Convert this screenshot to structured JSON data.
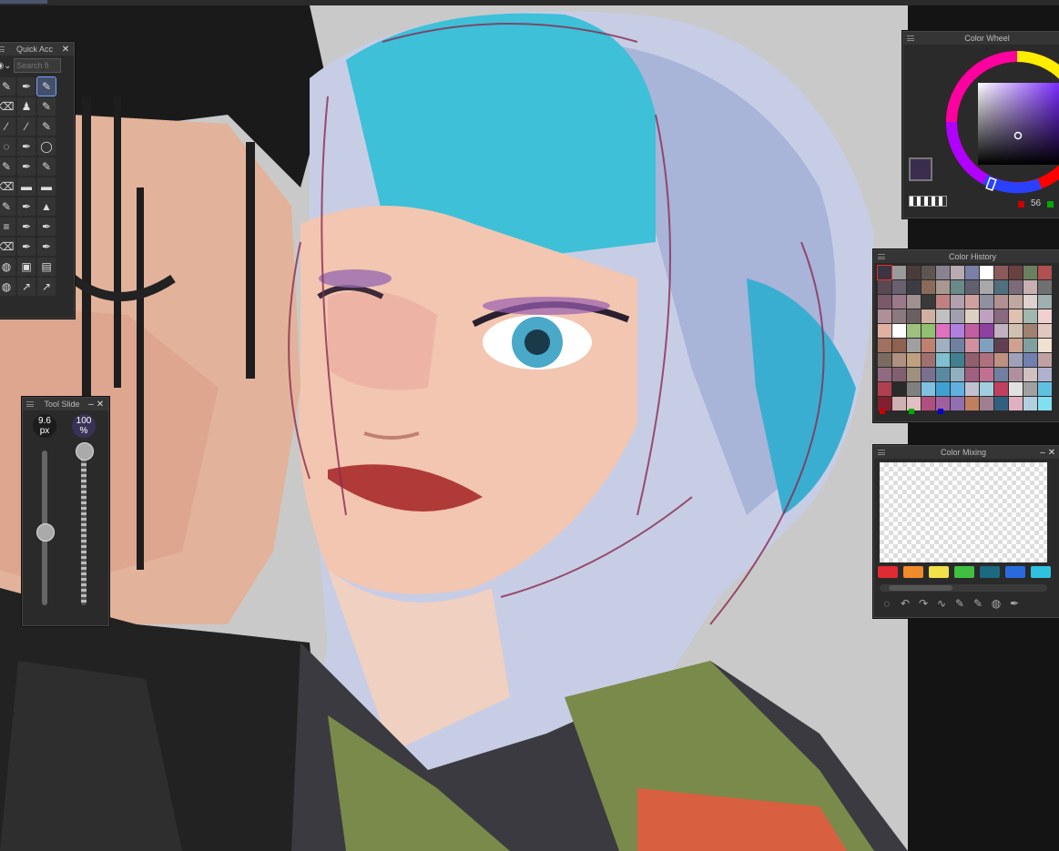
{
  "quick_access": {
    "title": "Quick Acc",
    "search_placeholder": "Search fi",
    "tools": [
      "✎",
      "✒",
      "✎",
      "⌫",
      "♟",
      "✎",
      "∕",
      "∕",
      "✎",
      "◌",
      "✒",
      "◯",
      "✎",
      "✒",
      "✎",
      "⌫",
      "▬",
      "▬",
      "✎",
      "✒",
      "▲",
      "≡",
      "✒",
      "✒",
      "⌫",
      "✒",
      "✒",
      "◍",
      "▣",
      "▤",
      "◍",
      "↗",
      "↗"
    ]
  },
  "tool_slider": {
    "title": "Tool Slide",
    "size_value": "9.6",
    "size_unit": "px",
    "opacity_value": "100",
    "opacity_unit": "%"
  },
  "color_wheel": {
    "title": "Color Wheel",
    "value_readout": "56",
    "current_color": "#3b2d4e"
  },
  "color_history": {
    "title": "Color History",
    "swatches": [
      "#3c3344",
      "#9a9a9a",
      "#4a3c3a",
      "#5e5450",
      "#8a8290",
      "#b8aab0",
      "#7a80a8",
      "#ffffff",
      "#8c5a5a",
      "#6a4040",
      "#6a8060",
      "#b05050",
      "#5a4a50",
      "#6a6070",
      "#3c3c44",
      "#8a6a5a",
      "#a89890",
      "#6a8a8a",
      "#606070",
      "#a8a8a8",
      "#507080",
      "#7a6a7a",
      "#c8b0b0",
      "#707070",
      "#7a5a6a",
      "#9a7a8a",
      "#a09090",
      "#3a3a3a",
      "#c08080",
      "#b0a0b0",
      "#d0a0a0",
      "#9090a0",
      "#b09090",
      "#c0a8a0",
      "#e0d0d0",
      "#a0b0b0",
      "#b09098",
      "#8a7a80",
      "#6a6060",
      "#d0b0a0",
      "#c0c0c0",
      "#a0a0b0",
      "#ddd0c0",
      "#c0a0c0",
      "#8a6a80",
      "#e0c0b0",
      "#a0b8b0",
      "#f0d0d0",
      "#e0b0a0",
      "#ffffff",
      "#a0c080",
      "#90c070",
      "#e070c0",
      "#b080e0",
      "#c060a0",
      "#9040a0",
      "#c0b0c0",
      "#d0c0b0",
      "#a08070",
      "#e0c8c0",
      "#a07060",
      "#906050",
      "#a0a0a0",
      "#c08070",
      "#a0b0c0",
      "#7080a0",
      "#d090a0",
      "#80a0c0",
      "#604050",
      "#d0a090",
      "#80a0a0",
      "#f0e0d0",
      "#7a6a60",
      "#b09080",
      "#c0a080",
      "#a07070",
      "#80c0d0",
      "#408090",
      "#906070",
      "#b07080",
      "#c09080",
      "#a0a0b8",
      "#7080b0",
      "#c0a0a0",
      "#906a80",
      "#806070",
      "#a09080",
      "#7a7090",
      "#5a8aa0",
      "#90b0c0",
      "#a06080",
      "#c07090",
      "#7080a0",
      "#b090a0",
      "#d0c0c0",
      "#b0b0d0",
      "#b04050",
      "#2a2a2a",
      "#808080",
      "#80c0e0",
      "#40a0d0",
      "#60b0e0",
      "#c0c0d0",
      "#a0d0e0",
      "#c04060",
      "#e0e0e0",
      "#a0a0a0",
      "#60c0e0",
      "#802030",
      "#d0b0b0",
      "#e0c0c0",
      "#b05080",
      "#a060a0",
      "#9070b0",
      "#c08060",
      "#a08090",
      "#306080",
      "#e0b0c0",
      "#b0d0e0",
      "#80e0f0"
    ]
  },
  "color_mixing": {
    "title": "Color Mixing",
    "palette": [
      "#e02a34",
      "#f08a2a",
      "#f0e04a",
      "#40c040",
      "#1a6a80",
      "#2a6ae0",
      "#30c0e0"
    ],
    "tools": [
      "◌",
      "↶",
      "↷",
      "∿",
      "✎",
      "✎",
      "◍",
      "✒"
    ]
  }
}
